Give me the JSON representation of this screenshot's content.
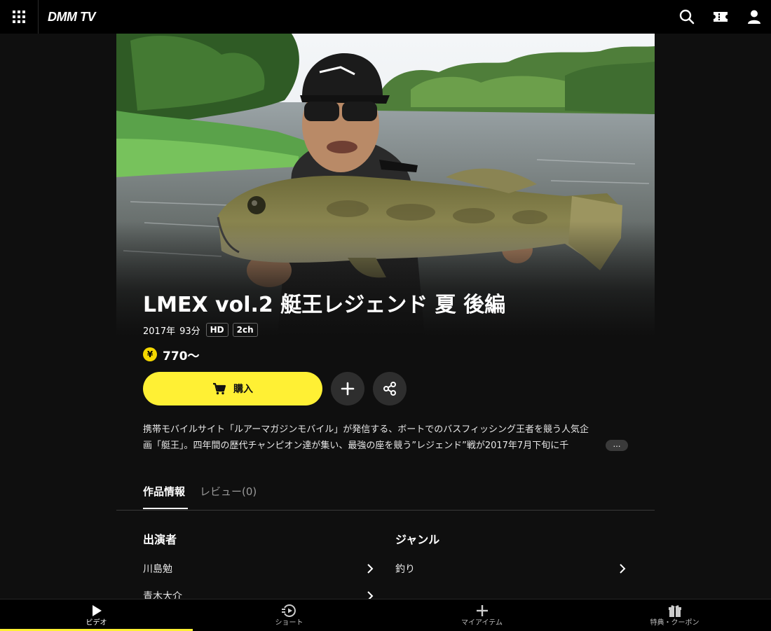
{
  "header": {
    "logo": "DMM TV"
  },
  "title": {
    "text": "LMEX vol.2 艇王レジェンド 夏 後編"
  },
  "meta": {
    "year": "2017年",
    "duration": "93分",
    "badges": [
      "HD",
      "2ch"
    ]
  },
  "price": {
    "currency_symbol": "¥",
    "text": "770〜"
  },
  "actions": {
    "buy_label": "購入"
  },
  "description": {
    "line1": "携帯モバイルサイト「ルアーマガジンモバイル」が発信する、ボートでのバスフィッシング王者を競う人気企",
    "line2": "画「艇王」。四年間の歴代チャンピオン達が集い、最強の座を競う”レジェンド”戦が2017年7月下旬に千",
    "more_label": "…"
  },
  "tabs": [
    {
      "label": "作品情報",
      "active": true
    },
    {
      "label": "レビュー(0)",
      "active": false
    }
  ],
  "cast": {
    "title": "出演者",
    "items": [
      "川島勉",
      "青木大介"
    ]
  },
  "genre": {
    "title": "ジャンル",
    "items": [
      "釣り"
    ]
  },
  "bottom_nav": [
    {
      "label": "ビデオ",
      "icon": "play-icon",
      "active": true
    },
    {
      "label": "ショート",
      "icon": "short-icon",
      "active": false
    },
    {
      "label": "マイアイテム",
      "icon": "plus-icon",
      "active": false
    },
    {
      "label": "特典・クーポン",
      "icon": "gift-icon",
      "active": false
    }
  ],
  "colors": {
    "accent": "#fff034",
    "background": "#0f0f0f",
    "header": "#000000"
  }
}
